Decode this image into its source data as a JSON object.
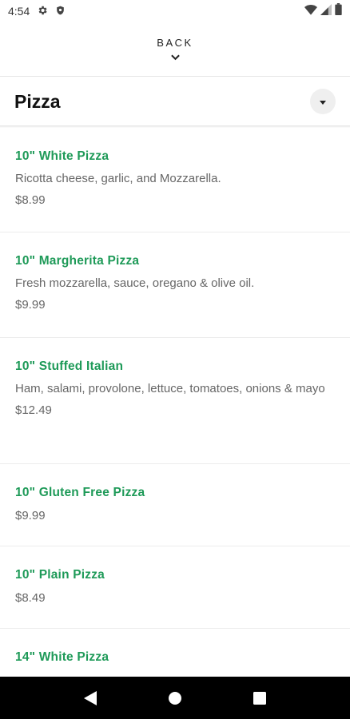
{
  "status_bar": {
    "time": "4:54",
    "icons_left": [
      "gear-icon",
      "shield-icon"
    ],
    "icons_right": [
      "wifi-icon",
      "signal-icon",
      "battery-icon"
    ]
  },
  "nav": {
    "back_label": "BACK"
  },
  "category": {
    "title": "Pizza"
  },
  "colors": {
    "accent": "#1e9a58",
    "text_secondary": "#666666"
  },
  "items": [
    {
      "name": "10\" White Pizza",
      "description": "Ricotta cheese, garlic, and Mozzarella.",
      "price": "$8.99"
    },
    {
      "name": "10\" Margherita Pizza",
      "description": "Fresh mozzarella, sauce, oregano & olive oil.",
      "price": "$9.99"
    },
    {
      "name": "10\" Stuffed Italian",
      "description": "Ham, salami, provolone, lettuce, tomatoes, onions & mayo",
      "price": "$12.49"
    },
    {
      "name": "10\" Gluten Free Pizza",
      "description": "",
      "price": "$9.99"
    },
    {
      "name": "10\" Plain Pizza",
      "description": "",
      "price": "$8.49"
    },
    {
      "name": "14\" White Pizza",
      "description": "",
      "price": ""
    }
  ],
  "system_nav": {
    "buttons": [
      "back-triangle-icon",
      "home-circle-icon",
      "recents-square-icon"
    ]
  }
}
